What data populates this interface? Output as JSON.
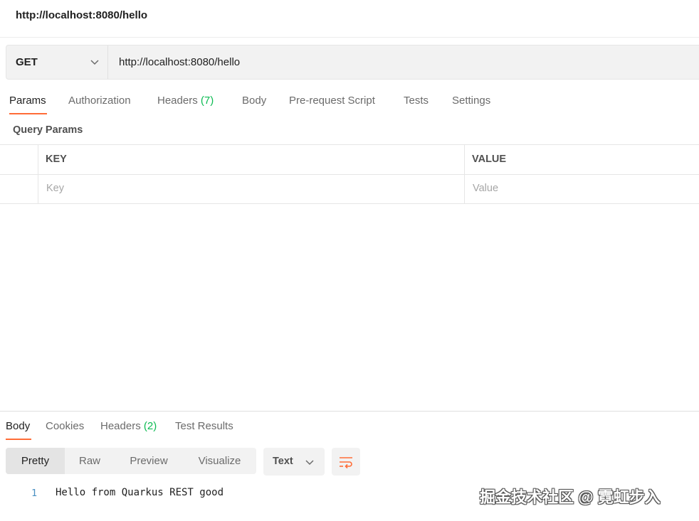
{
  "request": {
    "title": "http://localhost:8080/hello",
    "method": "GET",
    "url": "http://localhost:8080/hello"
  },
  "request_tabs": [
    {
      "label": "Params",
      "count": ""
    },
    {
      "label": "Authorization",
      "count": ""
    },
    {
      "label": "Headers",
      "count": "(7)"
    },
    {
      "label": "Body",
      "count": ""
    },
    {
      "label": "Pre-request Script",
      "count": ""
    },
    {
      "label": "Tests",
      "count": ""
    },
    {
      "label": "Settings",
      "count": ""
    }
  ],
  "params": {
    "section_label": "Query Params",
    "key_header": "KEY",
    "value_header": "VALUE",
    "key_placeholder": "Key",
    "value_placeholder": "Value"
  },
  "response_tabs": [
    {
      "label": "Body",
      "count": ""
    },
    {
      "label": "Cookies",
      "count": ""
    },
    {
      "label": "Headers",
      "count": "(2)"
    },
    {
      "label": "Test Results",
      "count": ""
    }
  ],
  "view_modes": [
    "Pretty",
    "Raw",
    "Preview",
    "Visualize"
  ],
  "format": "Text",
  "response_body": {
    "line_number": "1",
    "text": "Hello from Quarkus REST good"
  },
  "watermark": "掘金技术社区 @ 霓虹步入",
  "colors": {
    "accent": "#ff6c37",
    "count_green": "#0cbb52",
    "line_number_blue": "#4a90c2"
  },
  "icons": {
    "method_dropdown": "chevron-down-icon",
    "format_dropdown": "chevron-down-icon",
    "wrap": "wrap-lines-icon"
  }
}
